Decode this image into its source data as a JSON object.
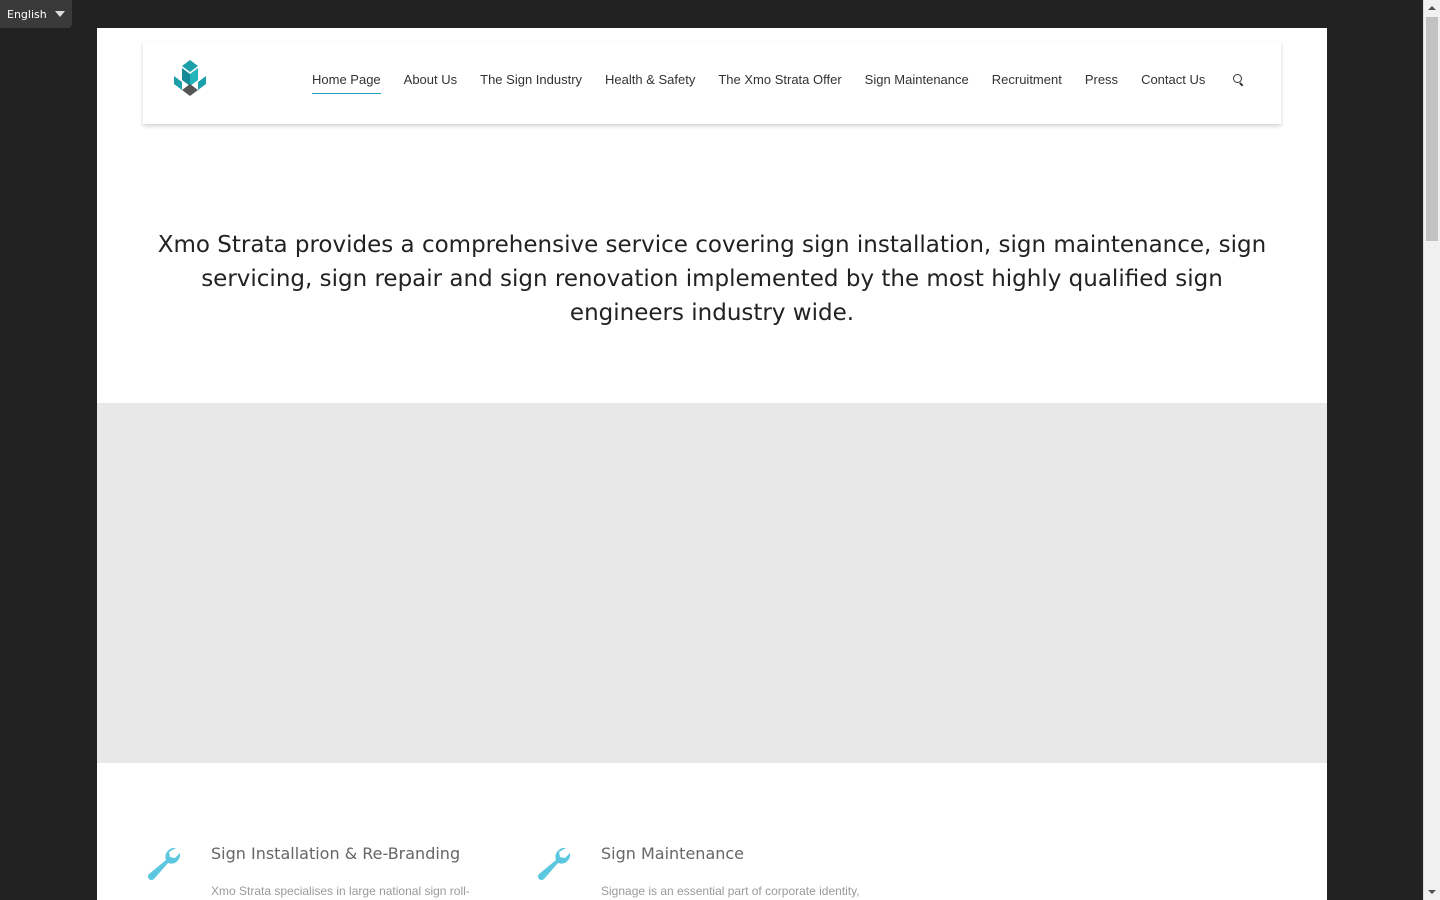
{
  "language_selector": {
    "label": "English"
  },
  "brand": {
    "accent_color": "#1fa9c4",
    "logo_icon": "cube-logo-icon"
  },
  "nav": {
    "items": [
      {
        "label": "Home Page",
        "active": true
      },
      {
        "label": "About Us"
      },
      {
        "label": "The Sign Industry"
      },
      {
        "label": "Health & Safety"
      },
      {
        "label": "The Xmo Strata Offer"
      },
      {
        "label": "Sign Maintenance"
      },
      {
        "label": "Recruitment"
      },
      {
        "label": "Press"
      },
      {
        "label": "Contact Us"
      }
    ],
    "search_icon": "search-icon"
  },
  "intro": {
    "text": "Xmo Strata provides a comprehensive service covering sign installation, sign maintenance, sign servicing, sign repair and sign renovation implemented by the most highly qualified sign engineers industry wide."
  },
  "features": [
    {
      "icon": "wrench-icon",
      "title": "Sign Installation & Re-Branding",
      "text": "Xmo Strata specialises in large national sign roll-"
    },
    {
      "icon": "wrench-icon",
      "title": "Sign Maintenance",
      "text": "Signage is an essential part of corporate identity,"
    }
  ]
}
